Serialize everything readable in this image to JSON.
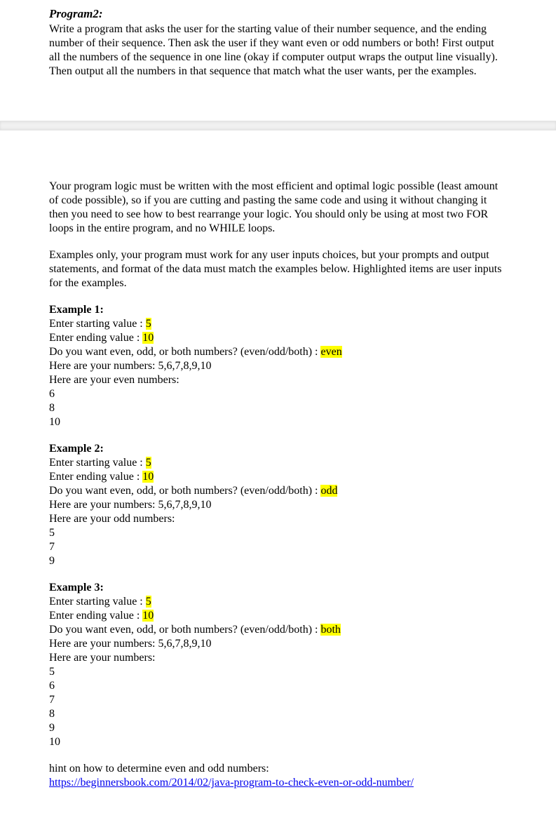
{
  "top": {
    "heading": "Program2:",
    "description": "Write a program that asks the user for the starting value of their number sequence, and the ending number of their sequence. Then ask the user if they want even or odd numbers or both! First output all the numbers of the sequence in one line (okay if computer output wraps the output line visually). Then output all the numbers in that sequence that match what the user wants, per the examples."
  },
  "bottom": {
    "para1": "Your program logic must be written with the most efficient and optimal logic possible (least amount of code possible), so if you are cutting and pasting the same code and using it without changing it then you need to see how to best rearrange your logic. You should only be using at most two FOR loops in the entire program, and no WHILE loops.",
    "para2": "Examples only, your program must work for any user inputs choices, but your prompts and output statements, and format of the data must match the examples below. Highlighted items are user inputs for the examples.",
    "examples": [
      {
        "title": "Example 1:",
        "start_label": "Enter starting value : ",
        "start_value": "5",
        "end_label": "Enter ending value : ",
        "end_value": "10",
        "choice_label": "Do you want even, odd, or both numbers? (even/odd/both) : ",
        "choice_value": "even",
        "allnums_label": "Here are your numbers: 5,6,7,8,9,10",
        "filter_label": "Here are your even numbers:",
        "outputs": [
          "6",
          "8",
          "10"
        ]
      },
      {
        "title": "Example 2:",
        "start_label": "Enter starting value : ",
        "start_value": "5",
        "end_label": "Enter ending value : ",
        "end_value": "10",
        "choice_label": "Do you want even, odd, or both numbers? (even/odd/both) : ",
        "choice_value": "odd",
        "allnums_label": "Here are your numbers: 5,6,7,8,9,10",
        "filter_label": "Here are your odd numbers:",
        "outputs": [
          "5",
          "7",
          "9"
        ]
      },
      {
        "title": "Example 3:",
        "start_label": "Enter starting value : ",
        "start_value": "5",
        "end_label": "Enter ending value : ",
        "end_value": "10",
        "choice_label": "Do you want even, odd, or both numbers? (even/odd/both) : ",
        "choice_value": "both",
        "allnums_label": "Here are your numbers: 5,6,7,8,9,10",
        "filter_label": "Here are your numbers:",
        "outputs": [
          "5",
          "6",
          "7",
          "8",
          "9",
          "10"
        ]
      }
    ],
    "hint_label": "hint on how to determine even and odd numbers:",
    "hint_link": "https://beginnersbook.com/2014/02/java-program-to-check-even-or-odd-number/"
  }
}
